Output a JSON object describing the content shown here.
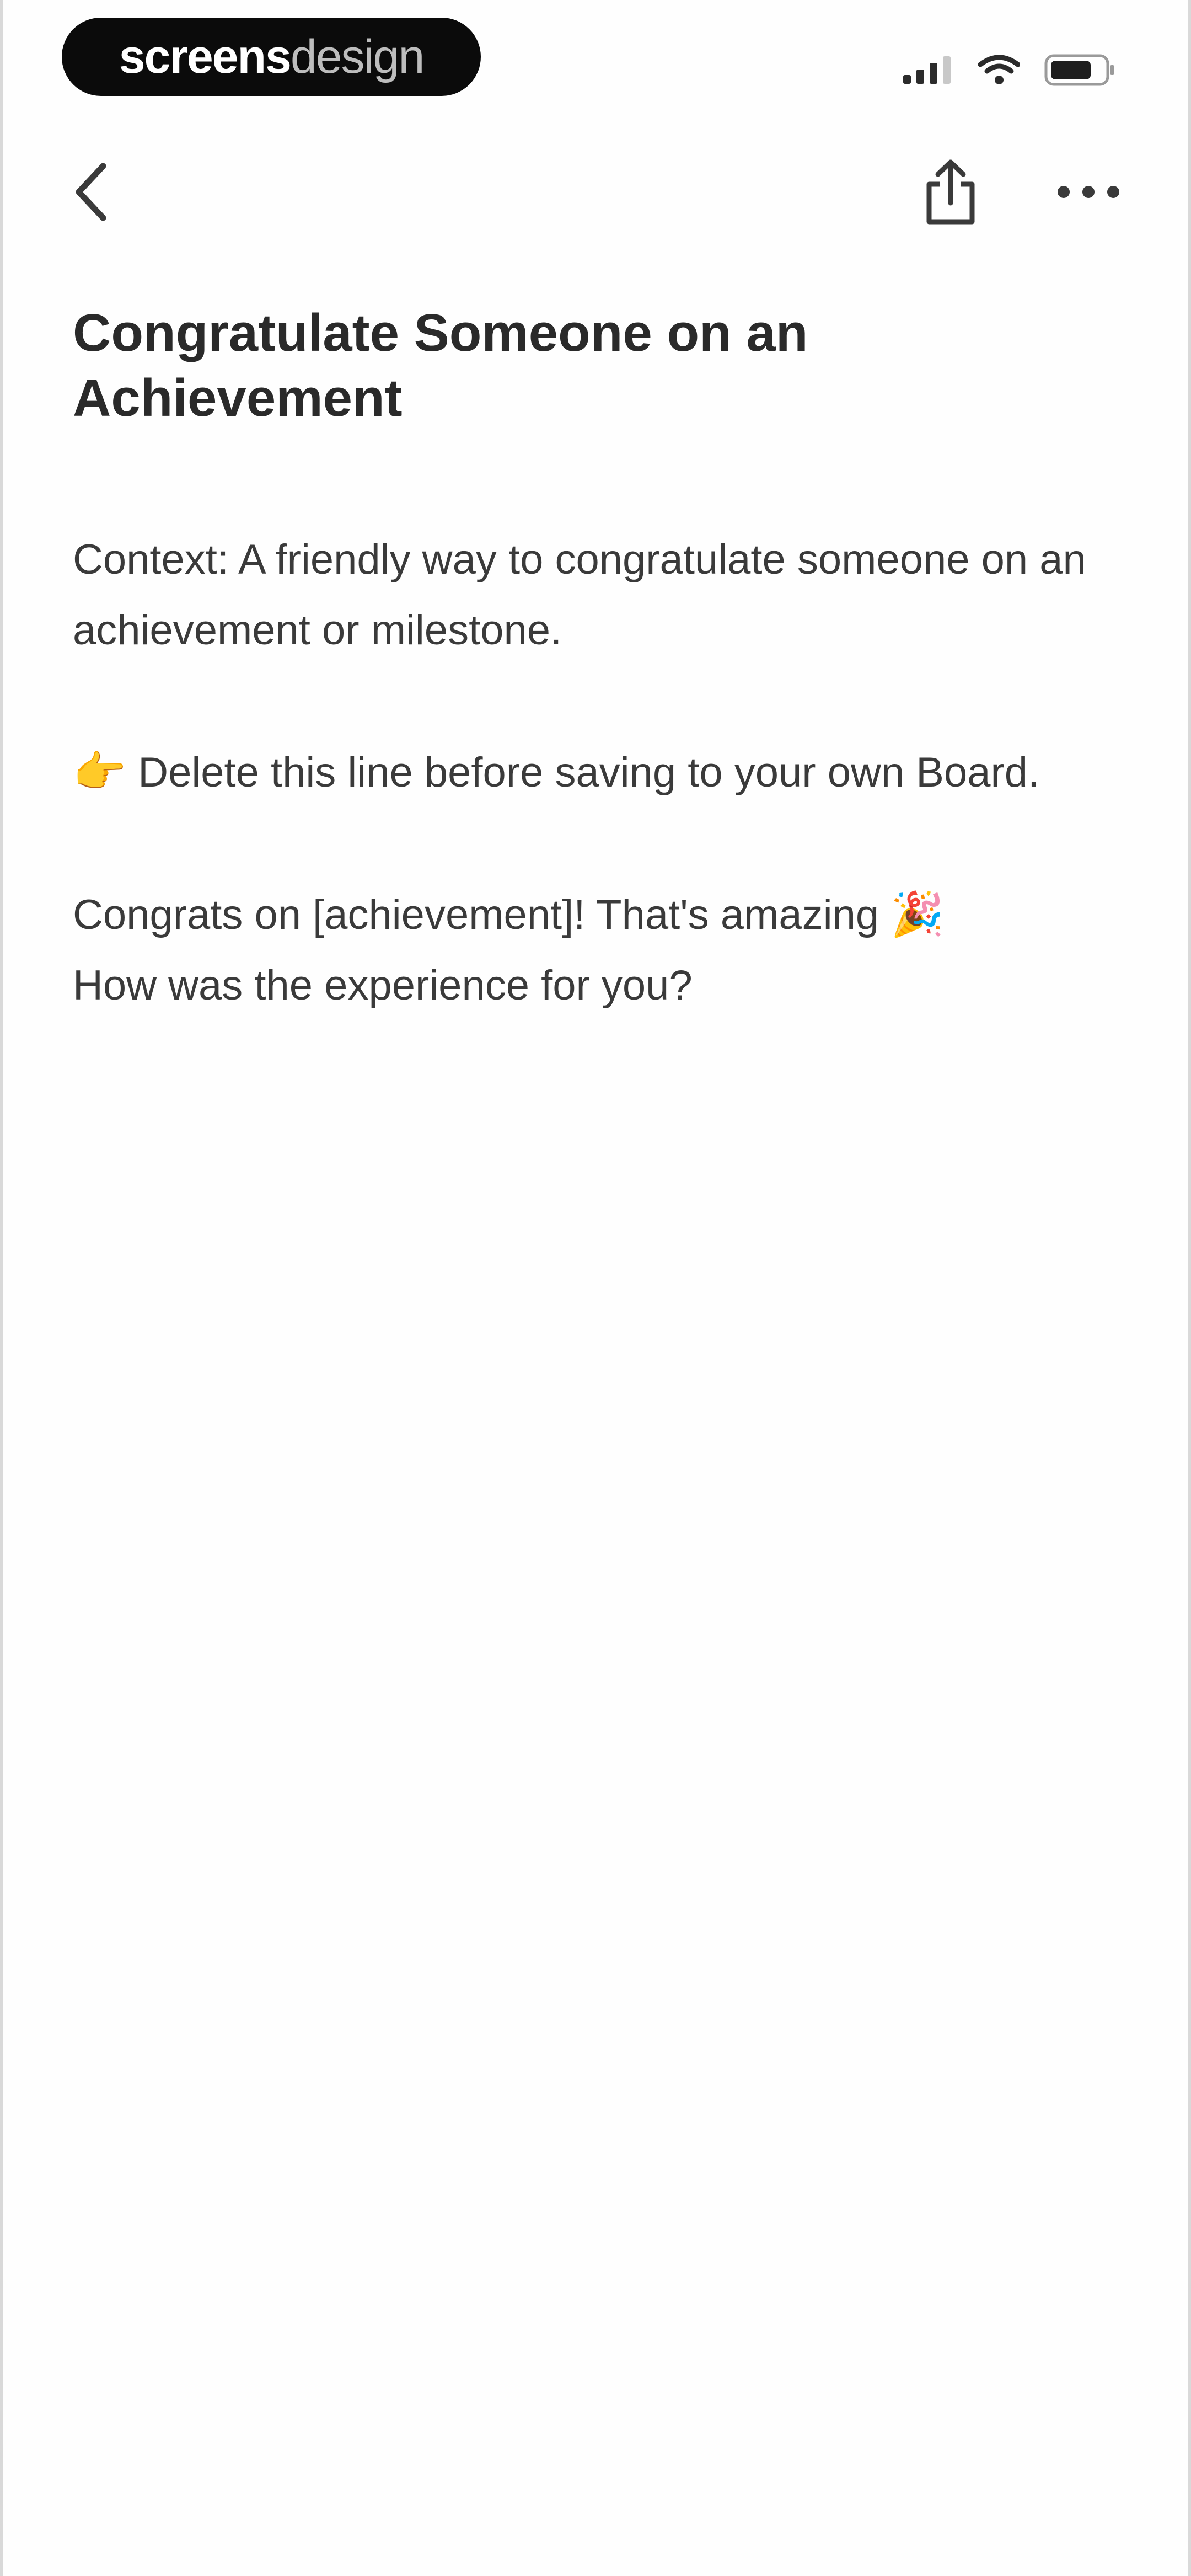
{
  "status_bar": {
    "brand_strong": "screens",
    "brand_light": "design",
    "signal_icon": "cellular-signal-icon",
    "wifi_icon": "wifi-icon",
    "battery_icon": "battery-icon"
  },
  "nav": {
    "back_icon": "chevron-left-icon",
    "share_icon": "share-icon",
    "more_icon": "more-horizontal-icon"
  },
  "page": {
    "title": "Congratulate Someone on an Achievement",
    "context": "Context: A friendly way to congratulate someone on an achievement or milestone.",
    "note_emoji": "👉",
    "note_text": " Delete this line before saving to your own Board.",
    "message_text": "Congrats on [achievement]! That's amazing ",
    "message_emoji": "🎉",
    "message_question": "How was the experience for you?"
  },
  "colors": {
    "background": "#fefefe",
    "text": "#3a3a3a",
    "title": "#2a2a2a",
    "pill": "#0b0b0b"
  }
}
